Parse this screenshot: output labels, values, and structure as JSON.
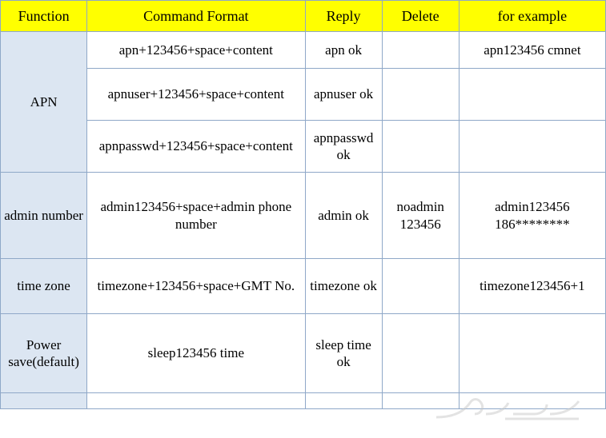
{
  "table": {
    "headers": [
      "Function",
      "Command Format",
      "Reply",
      "Delete",
      "for example"
    ],
    "rows": [
      {
        "function": "APN",
        "function_rowspan": 3,
        "lines": [
          {
            "command": "apn+123456+space+content",
            "reply": "apn ok",
            "delete": "",
            "example": "apn123456 cmnet"
          },
          {
            "command": "apnuser+123456+space+content",
            "reply": "apnuser ok",
            "delete": "",
            "example": ""
          },
          {
            "command": "apnpasswd+123456+space+content",
            "reply": "apnpasswd ok",
            "delete": "",
            "example": ""
          }
        ]
      },
      {
        "function": "admin number",
        "function_rowspan": 1,
        "lines": [
          {
            "command": "admin123456+space+admin phone number",
            "reply": "admin ok",
            "delete": "noadmin 123456",
            "example": "admin123456 186********"
          }
        ]
      },
      {
        "function": "time zone",
        "function_rowspan": 1,
        "lines": [
          {
            "command": "timezone+123456+space+GMT No.",
            "reply": "timezone ok",
            "delete": "",
            "example": "timezone123456+1"
          }
        ]
      },
      {
        "function": "Power save(default)",
        "function_rowspan": 1,
        "lines": [
          {
            "command": "sleep123456 time",
            "reply": "sleep time ok",
            "delete": "",
            "example": ""
          }
        ]
      },
      {
        "function": "",
        "function_rowspan": 1,
        "lines": [
          {
            "command": "",
            "reply": "",
            "delete": "",
            "example": ""
          }
        ]
      }
    ]
  },
  "colors": {
    "header_bg": "#ffff00",
    "function_bg": "#dce6f2",
    "border": "#8fa8c8"
  }
}
